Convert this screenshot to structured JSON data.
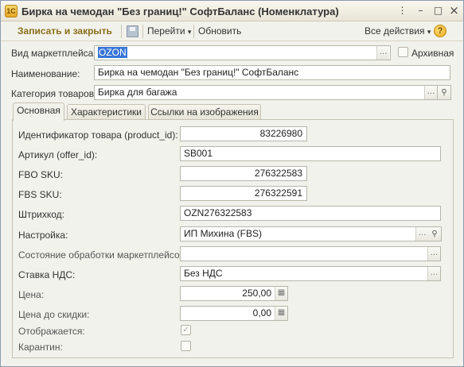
{
  "window": {
    "title": "Бирка на чемодан \"Без границ!\" СофтБаланс (Номенклатура)",
    "controls": {
      "more": "⋮",
      "minimize": "–",
      "maximize": "□",
      "close": "×"
    }
  },
  "toolbar": {
    "save_close_label": "Записать и закрыть",
    "goto_label": "Перейти",
    "update_label": "Обновить",
    "all_actions_label": "Все действия",
    "help_label": "?"
  },
  "header": {
    "marketplace_label": "Вид маркетплейса:",
    "marketplace_value": "OZON",
    "archive_label": "Архивная",
    "name_label": "Наименование:",
    "name_value": "Бирка на чемодан \"Без границ!\" СофтБаланс",
    "category_label": "Категория товаров:",
    "category_value": "Бирка для багажа"
  },
  "tabs": [
    {
      "label": "Основная",
      "active": true
    },
    {
      "label": "Характеристики",
      "active": false
    },
    {
      "label": "Ссылки на изображения",
      "active": false
    }
  ],
  "main": {
    "product_id_label": "Идентификатор товара (product_id):",
    "product_id_value": "83226980",
    "offer_id_label": "Артикул (offer_id):",
    "offer_id_value": "SB001",
    "fbo_sku_label": "FBO SKU:",
    "fbo_sku_value": "276322583",
    "fbs_sku_label": "FBS SKU:",
    "fbs_sku_value": "276322591",
    "barcode_label": "Штрихкод:",
    "barcode_value": "OZN276322583",
    "setting_label": "Настройка:",
    "setting_value": "ИП Михина (FBS)",
    "state_label": "Состояние обработки маркетплейсом:",
    "state_value": "",
    "vat_label": "Ставка НДС:",
    "vat_value": "Без НДС",
    "price_label": "Цена:",
    "price_value": "250,00",
    "price_before_label": "Цена до скидки:",
    "price_before_value": "0,00",
    "displayed_label": "Отображается:",
    "displayed_checked": true,
    "quarantine_label": "Карантин:",
    "quarantine_checked": false
  },
  "icons": {
    "more": "...",
    "search": "⚲",
    "dropdown": "▾",
    "calc": "▦",
    "check": "✓"
  }
}
